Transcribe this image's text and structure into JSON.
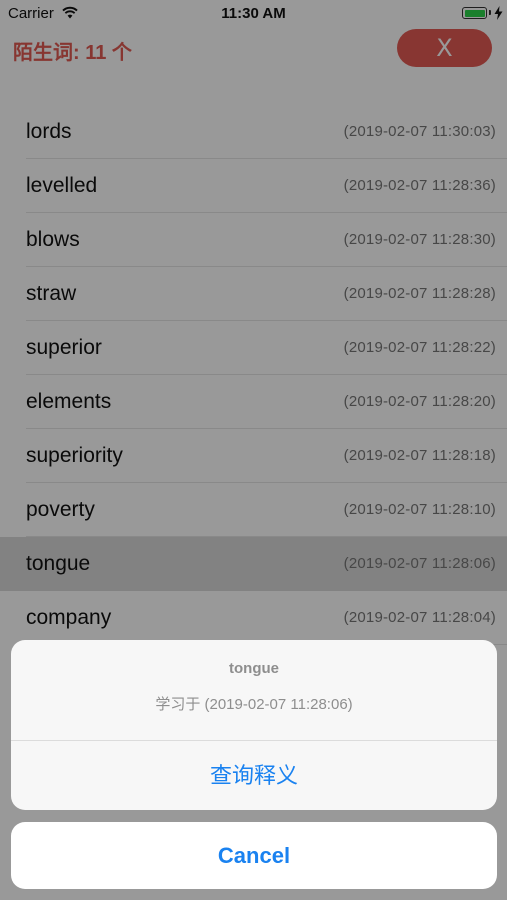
{
  "status_bar": {
    "carrier": "Carrier",
    "time": "11:30 AM"
  },
  "header": {
    "title": "陌生词: 11 个",
    "close_label": "X"
  },
  "words": [
    {
      "word": "lords",
      "time": "(2019-02-07 11:30:03)"
    },
    {
      "word": "levelled",
      "time": "(2019-02-07 11:28:36)"
    },
    {
      "word": "blows",
      "time": "(2019-02-07 11:28:30)"
    },
    {
      "word": "straw",
      "time": "(2019-02-07 11:28:28)"
    },
    {
      "word": "superior",
      "time": "(2019-02-07 11:28:22)"
    },
    {
      "word": "elements",
      "time": "(2019-02-07 11:28:20)"
    },
    {
      "word": "superiority",
      "time": "(2019-02-07 11:28:18)"
    },
    {
      "word": "poverty",
      "time": "(2019-02-07 11:28:10)"
    },
    {
      "word": "tongue",
      "time": "(2019-02-07 11:28:06)"
    },
    {
      "word": "company",
      "time": "(2019-02-07 11:28:04)"
    }
  ],
  "action_sheet": {
    "title": "tongue",
    "message": "学习于 (2019-02-07 11:28:06)",
    "lookup_label": "查询释义",
    "cancel_label": "Cancel"
  },
  "colors": {
    "accent_red": "#e35a54",
    "action_blue": "#1a82f0",
    "battery_green": "#2bd44a"
  }
}
